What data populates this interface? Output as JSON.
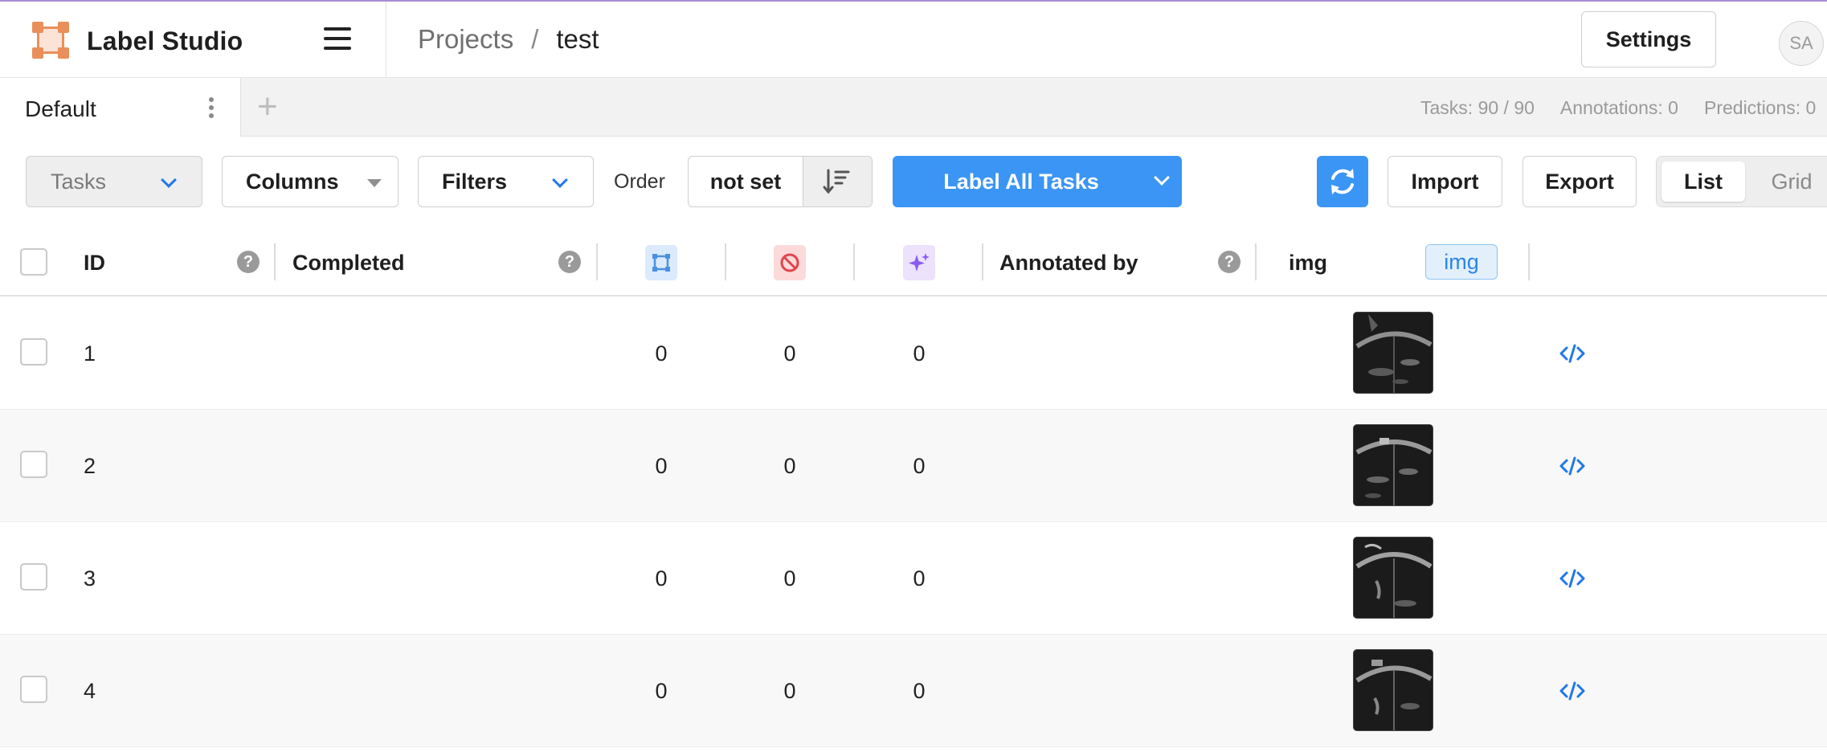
{
  "app": {
    "brand": "Label Studio",
    "user_initials": "SA"
  },
  "breadcrumb": {
    "projects": "Projects",
    "separator": "/",
    "current": "test"
  },
  "header": {
    "settings_label": "Settings"
  },
  "tabs": {
    "active": "Default",
    "add_symbol": "+"
  },
  "stats": {
    "tasks": "Tasks: 90 / 90",
    "annotations": "Annotations: 0",
    "predictions": "Predictions: 0"
  },
  "toolbar": {
    "tasks_label": "Tasks",
    "columns_label": "Columns",
    "filters_label": "Filters",
    "order_label": "Order",
    "order_value": "not set",
    "label_all": "Label All Tasks",
    "import": "Import",
    "export": "Export",
    "view_list": "List",
    "view_grid": "Grid"
  },
  "colors": {
    "accent": "#3b95f4",
    "link": "#1f78e8",
    "total_badge": "#dbeafc",
    "cancelled_badge": "#fcdada",
    "predictions_badge": "#ece2fb"
  },
  "table": {
    "columns": {
      "id": "ID",
      "completed": "Completed",
      "total_annotations_icon": "annotations-count-icon",
      "cancelled_icon": "cancelled-count-icon",
      "predictions_icon": "predictions-count-icon",
      "annotated_by": "Annotated by",
      "img": "img",
      "img_tag": "img"
    },
    "help_symbol": "?",
    "rows": [
      {
        "id": "1",
        "completed": "",
        "total": "0",
        "cancelled": "0",
        "predictions": "0",
        "annotated_by": ""
      },
      {
        "id": "2",
        "completed": "",
        "total": "0",
        "cancelled": "0",
        "predictions": "0",
        "annotated_by": ""
      },
      {
        "id": "3",
        "completed": "",
        "total": "0",
        "cancelled": "0",
        "predictions": "0",
        "annotated_by": ""
      },
      {
        "id": "4",
        "completed": "",
        "total": "0",
        "cancelled": "0",
        "predictions": "0",
        "annotated_by": ""
      }
    ]
  }
}
